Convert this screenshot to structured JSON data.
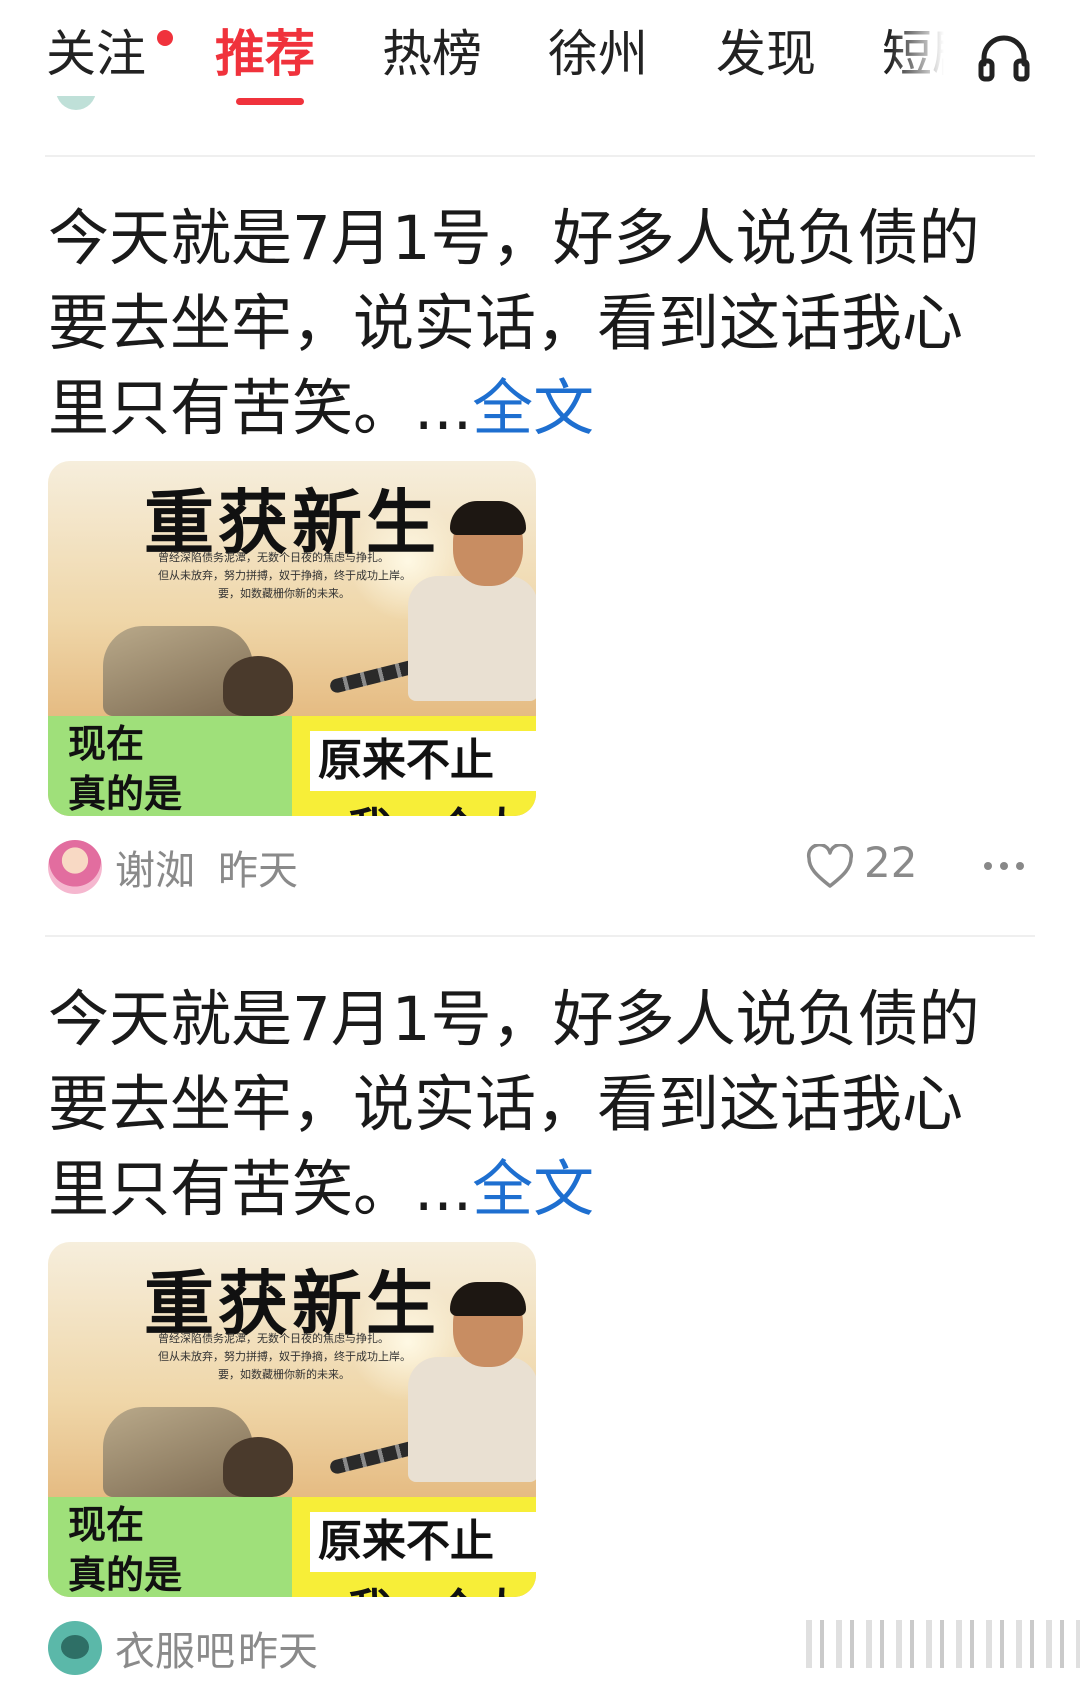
{
  "tabs": [
    {
      "label": "关注",
      "active": false,
      "has_dot": true
    },
    {
      "label": "推荐",
      "active": true
    },
    {
      "label": "热榜",
      "active": false
    },
    {
      "label": "徐州",
      "active": false
    },
    {
      "label": "发现",
      "active": false
    },
    {
      "label": "短剧",
      "active": false
    }
  ],
  "header_icon": "headphone-icon",
  "accent_color": "#f0323c",
  "link_color": "#1e6fd0",
  "posts": [
    {
      "text_lines": [
        "今天就是7月1号，好多人说负债的",
        "要去坐牢，说实话，看到这话我心",
        "里只有苦笑。..."
      ],
      "more_label": "全文",
      "image": {
        "headline": "重获新生",
        "sub_lines": [
          "曾经深陷债务泥潭，无数个日夜的焦虑与挣扎。",
          "但从未放弃，努力拼搏，奴于挣摘，终于成功上岸。",
          "要，如数藏栅你新的未来。"
        ],
        "left_caption_lines": [
          "现在",
          "真的是"
        ],
        "right_caption": "原来不止",
        "right_caption_2": "我一个人"
      },
      "author": "谢洳",
      "time": "昨天",
      "likes": "22"
    },
    {
      "text_lines": [
        "今天就是7月1号，好多人说负债的",
        "要去坐牢，说实话，看到这话我心",
        "里只有苦笑。..."
      ],
      "more_label": "全文",
      "image": {
        "headline": "重获新生",
        "sub_lines": [
          "曾经深陷债务泥潭，无数个日夜的焦虑与挣扎。",
          "但从未放弃，努力拼搏，奴于挣摘，终于成功上岸。",
          "要，如数藏栅你新的未来。"
        ],
        "left_caption_lines": [
          "现在",
          "真的是"
        ],
        "right_caption": "原来不止",
        "right_caption_2": "我一个人"
      },
      "author": "衣服吧",
      "time": "昨天"
    }
  ]
}
